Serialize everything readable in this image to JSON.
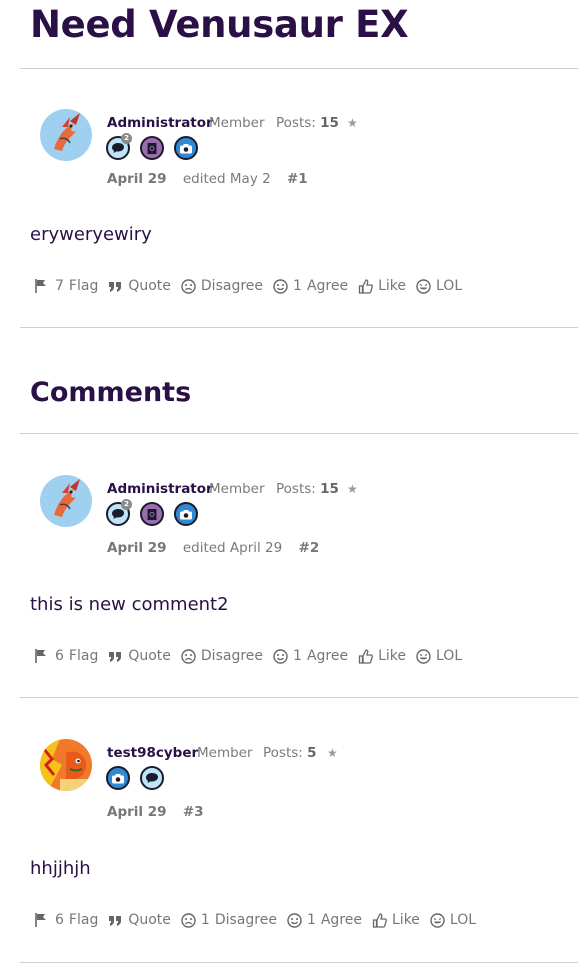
{
  "discussion": {
    "title": "Need Venusaur EX"
  },
  "comments_heading": "Comments",
  "posts": [
    {
      "author": "Administrator",
      "role": "Member",
      "posts_label": "Posts:",
      "posts_count": "15",
      "date": "April 29",
      "edited": "edited May 2",
      "number": "#1",
      "body": "eryweryewiry",
      "flag_count": "7",
      "reactions": {
        "flag": "Flag",
        "quote": "Quote",
        "disagree": "Disagree",
        "disagree_count": "",
        "agree": "Agree",
        "agree_count": "1",
        "like": "Like",
        "lol": "LOL"
      },
      "badge_count": "2"
    },
    {
      "author": "Administrator",
      "role": "Member",
      "posts_label": "Posts:",
      "posts_count": "15",
      "date": "April 29",
      "edited": "edited April 29",
      "number": "#2",
      "body": "this is new comment2",
      "flag_count": "6",
      "reactions": {
        "flag": "Flag",
        "quote": "Quote",
        "disagree": "Disagree",
        "disagree_count": "",
        "agree": "Agree",
        "agree_count": "1",
        "like": "Like",
        "lol": "LOL"
      },
      "badge_count": "2"
    },
    {
      "author": "test98cyber",
      "role": "Member",
      "posts_label": "Posts:",
      "posts_count": "5",
      "date": "April 29",
      "edited": "",
      "number": "#3",
      "body": "hhjjhjh",
      "flag_count": "6",
      "reactions": {
        "flag": "Flag",
        "quote": "Quote",
        "disagree": "Disagree",
        "disagree_count": "1",
        "agree": "Agree",
        "agree_count": "1",
        "like": "Like",
        "lol": "LOL"
      }
    }
  ],
  "colors": {
    "heading": "#2a1046",
    "text": "#4a4a4a",
    "muted": "#7a7a7a",
    "rule": "#cfcfcf"
  }
}
